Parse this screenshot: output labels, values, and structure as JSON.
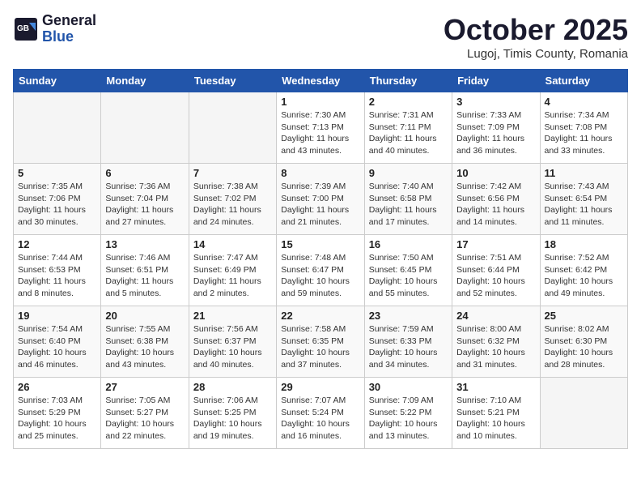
{
  "header": {
    "logo_general": "General",
    "logo_blue": "Blue",
    "month_title": "October 2025",
    "location": "Lugoj, Timis County, Romania"
  },
  "days_of_week": [
    "Sunday",
    "Monday",
    "Tuesday",
    "Wednesday",
    "Thursday",
    "Friday",
    "Saturday"
  ],
  "weeks": [
    [
      {
        "day": "",
        "info": ""
      },
      {
        "day": "",
        "info": ""
      },
      {
        "day": "",
        "info": ""
      },
      {
        "day": "1",
        "info": "Sunrise: 7:30 AM\nSunset: 7:13 PM\nDaylight: 11 hours and 43 minutes."
      },
      {
        "day": "2",
        "info": "Sunrise: 7:31 AM\nSunset: 7:11 PM\nDaylight: 11 hours and 40 minutes."
      },
      {
        "day": "3",
        "info": "Sunrise: 7:33 AM\nSunset: 7:09 PM\nDaylight: 11 hours and 36 minutes."
      },
      {
        "day": "4",
        "info": "Sunrise: 7:34 AM\nSunset: 7:08 PM\nDaylight: 11 hours and 33 minutes."
      }
    ],
    [
      {
        "day": "5",
        "info": "Sunrise: 7:35 AM\nSunset: 7:06 PM\nDaylight: 11 hours and 30 minutes."
      },
      {
        "day": "6",
        "info": "Sunrise: 7:36 AM\nSunset: 7:04 PM\nDaylight: 11 hours and 27 minutes."
      },
      {
        "day": "7",
        "info": "Sunrise: 7:38 AM\nSunset: 7:02 PM\nDaylight: 11 hours and 24 minutes."
      },
      {
        "day": "8",
        "info": "Sunrise: 7:39 AM\nSunset: 7:00 PM\nDaylight: 11 hours and 21 minutes."
      },
      {
        "day": "9",
        "info": "Sunrise: 7:40 AM\nSunset: 6:58 PM\nDaylight: 11 hours and 17 minutes."
      },
      {
        "day": "10",
        "info": "Sunrise: 7:42 AM\nSunset: 6:56 PM\nDaylight: 11 hours and 14 minutes."
      },
      {
        "day": "11",
        "info": "Sunrise: 7:43 AM\nSunset: 6:54 PM\nDaylight: 11 hours and 11 minutes."
      }
    ],
    [
      {
        "day": "12",
        "info": "Sunrise: 7:44 AM\nSunset: 6:53 PM\nDaylight: 11 hours and 8 minutes."
      },
      {
        "day": "13",
        "info": "Sunrise: 7:46 AM\nSunset: 6:51 PM\nDaylight: 11 hours and 5 minutes."
      },
      {
        "day": "14",
        "info": "Sunrise: 7:47 AM\nSunset: 6:49 PM\nDaylight: 11 hours and 2 minutes."
      },
      {
        "day": "15",
        "info": "Sunrise: 7:48 AM\nSunset: 6:47 PM\nDaylight: 10 hours and 59 minutes."
      },
      {
        "day": "16",
        "info": "Sunrise: 7:50 AM\nSunset: 6:45 PM\nDaylight: 10 hours and 55 minutes."
      },
      {
        "day": "17",
        "info": "Sunrise: 7:51 AM\nSunset: 6:44 PM\nDaylight: 10 hours and 52 minutes."
      },
      {
        "day": "18",
        "info": "Sunrise: 7:52 AM\nSunset: 6:42 PM\nDaylight: 10 hours and 49 minutes."
      }
    ],
    [
      {
        "day": "19",
        "info": "Sunrise: 7:54 AM\nSunset: 6:40 PM\nDaylight: 10 hours and 46 minutes."
      },
      {
        "day": "20",
        "info": "Sunrise: 7:55 AM\nSunset: 6:38 PM\nDaylight: 10 hours and 43 minutes."
      },
      {
        "day": "21",
        "info": "Sunrise: 7:56 AM\nSunset: 6:37 PM\nDaylight: 10 hours and 40 minutes."
      },
      {
        "day": "22",
        "info": "Sunrise: 7:58 AM\nSunset: 6:35 PM\nDaylight: 10 hours and 37 minutes."
      },
      {
        "day": "23",
        "info": "Sunrise: 7:59 AM\nSunset: 6:33 PM\nDaylight: 10 hours and 34 minutes."
      },
      {
        "day": "24",
        "info": "Sunrise: 8:00 AM\nSunset: 6:32 PM\nDaylight: 10 hours and 31 minutes."
      },
      {
        "day": "25",
        "info": "Sunrise: 8:02 AM\nSunset: 6:30 PM\nDaylight: 10 hours and 28 minutes."
      }
    ],
    [
      {
        "day": "26",
        "info": "Sunrise: 7:03 AM\nSunset: 5:29 PM\nDaylight: 10 hours and 25 minutes."
      },
      {
        "day": "27",
        "info": "Sunrise: 7:05 AM\nSunset: 5:27 PM\nDaylight: 10 hours and 22 minutes."
      },
      {
        "day": "28",
        "info": "Sunrise: 7:06 AM\nSunset: 5:25 PM\nDaylight: 10 hours and 19 minutes."
      },
      {
        "day": "29",
        "info": "Sunrise: 7:07 AM\nSunset: 5:24 PM\nDaylight: 10 hours and 16 minutes."
      },
      {
        "day": "30",
        "info": "Sunrise: 7:09 AM\nSunset: 5:22 PM\nDaylight: 10 hours and 13 minutes."
      },
      {
        "day": "31",
        "info": "Sunrise: 7:10 AM\nSunset: 5:21 PM\nDaylight: 10 hours and 10 minutes."
      },
      {
        "day": "",
        "info": ""
      }
    ]
  ]
}
